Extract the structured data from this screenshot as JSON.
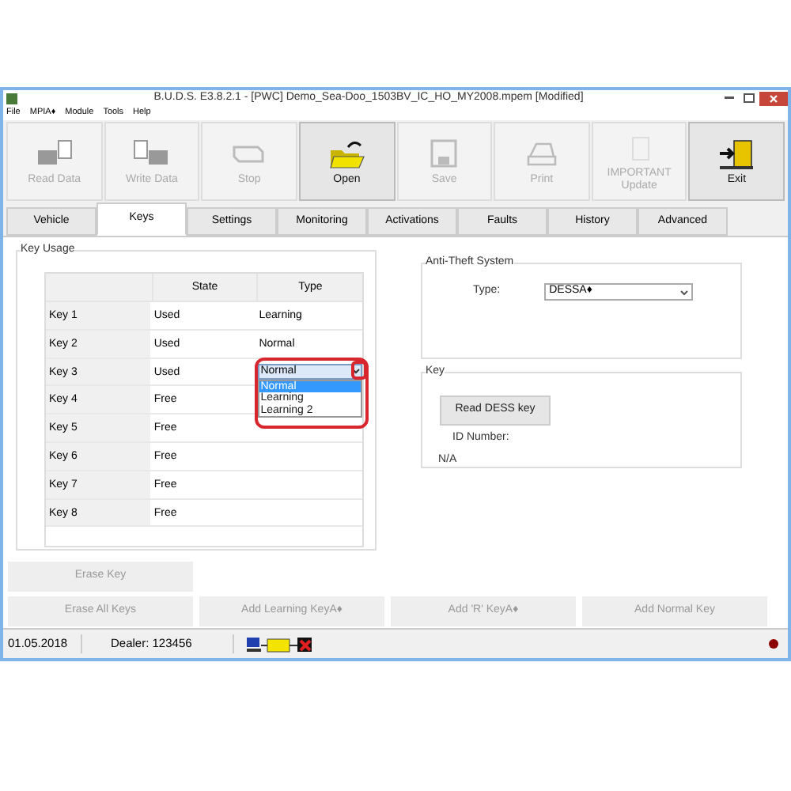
{
  "window": {
    "title": "B.U.D.S. E3.8.2.1 - [PWC] Demo_Sea-Doo_1503BV_IC_HO_MY2008.mpem [Modified]"
  },
  "menu": [
    "File",
    "MPIA♦",
    "Module",
    "Tools",
    "Help"
  ],
  "toolbar": [
    {
      "kind": "read",
      "label": "Read Data",
      "disabled": true
    },
    {
      "kind": "write",
      "label": "Write Data",
      "disabled": true
    },
    {
      "kind": "stop",
      "label": "Stop",
      "disabled": true
    },
    {
      "kind": "open",
      "label": "Open",
      "disabled": false
    },
    {
      "kind": "save",
      "label": "Save",
      "disabled": true
    },
    {
      "kind": "print",
      "label": "Print",
      "disabled": true
    },
    {
      "kind": "update",
      "label": "IMPORTANT Update",
      "disabled": true
    },
    {
      "kind": "exit",
      "label": "Exit",
      "disabled": false
    }
  ],
  "tabs": [
    {
      "label": "Vehicle",
      "selected": false
    },
    {
      "label": "Keys",
      "selected": true
    },
    {
      "label": "Settings",
      "selected": false
    },
    {
      "label": "Monitoring",
      "selected": false
    },
    {
      "label": "Activations",
      "selected": false
    },
    {
      "label": "Faults",
      "selected": false
    },
    {
      "label": "History",
      "selected": false
    },
    {
      "label": "Advanced",
      "selected": false
    }
  ],
  "key_usage": {
    "title": "Key Usage",
    "columns": [
      "State",
      "Type"
    ],
    "rows": [
      {
        "key": "Key 1",
        "state": "Used",
        "type": "Learning"
      },
      {
        "key": "Key 2",
        "state": "Used",
        "type": "Normal"
      },
      {
        "key": "Key 3",
        "state": "Used",
        "type_dropdown": {
          "value": "Normal",
          "options": [
            {
              "label": "Normal",
              "selected": true
            },
            {
              "label": "Learning",
              "selected": false
            },
            {
              "label": "Learning 2",
              "selected": false
            }
          ]
        }
      },
      {
        "key": "Key 4",
        "state": "Free"
      },
      {
        "key": "Key 5",
        "state": "Free"
      },
      {
        "key": "Key 6",
        "state": "Free"
      },
      {
        "key": "Key 7",
        "state": "Free"
      },
      {
        "key": "Key 8",
        "state": "Free"
      }
    ]
  },
  "anti_theft": {
    "title": "Anti-Theft System",
    "type_label": "Type:",
    "type_value": "DESSA♦"
  },
  "key_panel": {
    "title": "Key",
    "button": "Read DESS key",
    "id_label": "ID Number:",
    "id_value": "N/A"
  },
  "erase_key": {
    "label": "Erase Key",
    "disabled": true
  },
  "buttons": [
    {
      "label": "Erase All Keys",
      "disabled": true
    },
    {
      "label": "Add Learning KeyA♦",
      "disabled": true
    },
    {
      "label": "Add 'R' KeyA♦",
      "disabled": true
    },
    {
      "label": "Add Normal Key",
      "disabled": true
    }
  ],
  "status_bar": {
    "date": "01.05.2018",
    "dealer": "Dealer: 123456"
  }
}
